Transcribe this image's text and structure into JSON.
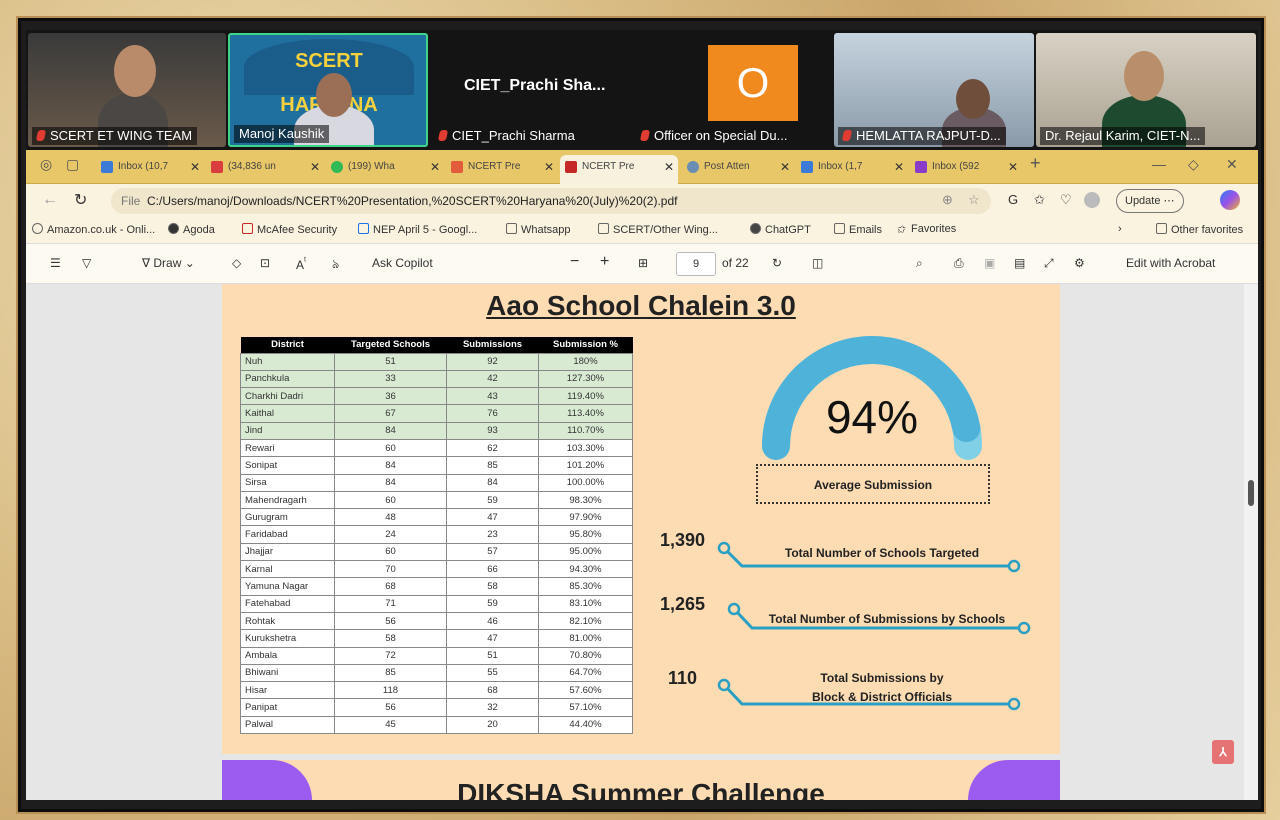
{
  "participants": [
    {
      "name": "SCERT ET WING TEAM"
    },
    {
      "name": "Manoj Kaushik",
      "logo_text": "SCERT HARYANA"
    },
    {
      "name": "CIET_Prachi Sharma",
      "big_name": "CIET_Prachi  Sha...",
      "avatar_letter": "O"
    },
    {
      "name": "Officer on Special Du..."
    },
    {
      "name": "HEMLATTA RAJPUT-D..."
    },
    {
      "name": "Dr. Rejaul Karim, CIET-N..."
    }
  ],
  "tabs": [
    {
      "label": "Inbox (10,7"
    },
    {
      "label": "(34,836 un"
    },
    {
      "label": "(199) Wha"
    },
    {
      "label": "NCERT Pre"
    },
    {
      "label": "NCERT Pre",
      "active": true
    },
    {
      "label": "Post Atten"
    },
    {
      "label": "Inbox (1,7"
    },
    {
      "label": "Inbox (592"
    }
  ],
  "address": {
    "file_label": "File",
    "url": "C:/Users/manoj/Downloads/NCERT%20Presentation,%20SCERT%20Haryana%20(July)%20(2).pdf",
    "update_label": "Update"
  },
  "bookmarks": [
    "Amazon.co.uk - Onli...",
    "Agoda",
    "McAfee Security",
    "NEP April 5 - Googl...",
    "Whatsapp",
    "SCERT/Other Wing...",
    "ChatGPT",
    "Emails",
    "Favorites",
    "Other favorites"
  ],
  "pdf_toolbar": {
    "draw": "Draw",
    "ask_copilot": "Ask Copilot",
    "page_current": "9",
    "page_total": "of 22",
    "edit_acrobat": "Edit with Acrobat"
  },
  "slide": {
    "title": "Aao School Chalein 3.0",
    "table_headers": [
      "District",
      "Targeted Schools",
      "Submissions",
      "Submission %"
    ],
    "rows": [
      [
        "Nuh",
        "51",
        "92",
        "180%"
      ],
      [
        "Panchkula",
        "33",
        "42",
        "127.30%"
      ],
      [
        "Charkhi Dadri",
        "36",
        "43",
        "119.40%"
      ],
      [
        "Kaithal",
        "67",
        "76",
        "113.40%"
      ],
      [
        "Jind",
        "84",
        "93",
        "110.70%"
      ],
      [
        "Rewari",
        "60",
        "62",
        "103.30%"
      ],
      [
        "Sonipat",
        "84",
        "85",
        "101.20%"
      ],
      [
        "Sirsa",
        "84",
        "84",
        "100.00%"
      ],
      [
        "Mahendragarh",
        "60",
        "59",
        "98.30%"
      ],
      [
        "Gurugram",
        "48",
        "47",
        "97.90%"
      ],
      [
        "Faridabad",
        "24",
        "23",
        "95.80%"
      ],
      [
        "Jhajjar",
        "60",
        "57",
        "95.00%"
      ],
      [
        "Karnal",
        "70",
        "66",
        "94.30%"
      ],
      [
        "Yamuna Nagar",
        "68",
        "58",
        "85.30%"
      ],
      [
        "Fatehabad",
        "71",
        "59",
        "83.10%"
      ],
      [
        "Rohtak",
        "56",
        "46",
        "82.10%"
      ],
      [
        "Kurukshetra",
        "58",
        "47",
        "81.00%"
      ],
      [
        "Ambala",
        "72",
        "51",
        "70.80%"
      ],
      [
        "Bhiwani",
        "85",
        "55",
        "64.70%"
      ],
      [
        "Hisar",
        "118",
        "68",
        "57.60%"
      ],
      [
        "Panipat",
        "56",
        "32",
        "57.10%"
      ],
      [
        "Palwal",
        "45",
        "20",
        "44.40%"
      ]
    ],
    "highlight_rows": 5,
    "gauge_value": "94%",
    "gauge_label": "Average Submission",
    "stats": [
      {
        "value": "1,390",
        "label": "Total Number of Schools Targeted"
      },
      {
        "value": "1,265",
        "label": "Total Number of Submissions by Schools"
      },
      {
        "value": "110",
        "label_line1": "Total Submissions by",
        "label_line2": "Block & District Officials"
      }
    ],
    "next_title": "DIKSHA Summer Challenge"
  },
  "colors": {
    "gauge": "#4fb3d9",
    "accent": "#28a0c8",
    "page_bg": "#fddcb4",
    "purple": "#9d5cf0"
  }
}
